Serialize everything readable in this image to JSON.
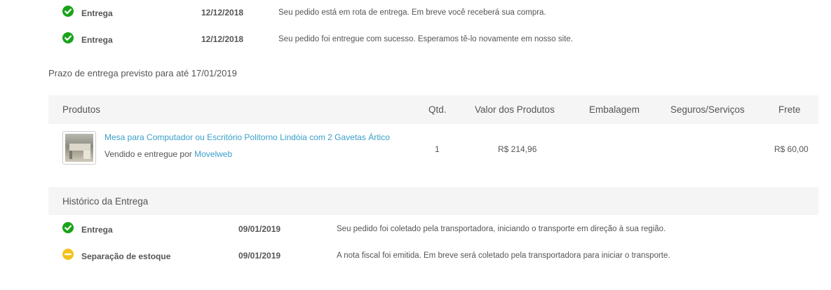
{
  "top_events": [
    {
      "status": "green",
      "label": "Entrega",
      "date": "12/12/2018",
      "message": "Seu pedido está em rota de entrega. Em breve você receberá sua compra."
    },
    {
      "status": "green",
      "label": "Entrega",
      "date": "12/12/2018",
      "message": "Seu pedido foi entregue com sucesso. Esperamos tê-lo novamente em nosso site."
    }
  ],
  "deadline_text": "Prazo de entrega previsto para até 17/01/2019",
  "products_table": {
    "headers": {
      "produtos": "Produtos",
      "qtd": "Qtd.",
      "valor": "Valor dos Produtos",
      "embalagem": "Embalagem",
      "seguros": "Seguros/Serviços",
      "frete": "Frete"
    },
    "row": {
      "name": "Mesa para Computador ou Escritório Politorno Lindóia com 2 Gavetas Ártico",
      "seller_prefix": "Vendido e entregue por",
      "seller": "Movelweb",
      "qty": "1",
      "value": "R$ 214,96",
      "embalagem": "",
      "seguros": "",
      "frete": "R$ 60,00"
    }
  },
  "history": {
    "title": "Histórico da Entrega",
    "events": [
      {
        "status": "green",
        "label": "Entrega",
        "date": "09/01/2019",
        "message": "Seu pedido foi coletado pela transportadora, iniciando o transporte em direção à sua região."
      },
      {
        "status": "yellow",
        "label": "Separação de estoque",
        "date": "09/01/2019",
        "message": "A nota fiscal foi emitida. Em breve será coletado pela transportadora para iniciar o transporte."
      }
    ]
  },
  "colors": {
    "success": "#1aa31a",
    "pending": "#f1c21b",
    "link": "#3a9fc9",
    "header_bg": "#f5f5f5"
  }
}
